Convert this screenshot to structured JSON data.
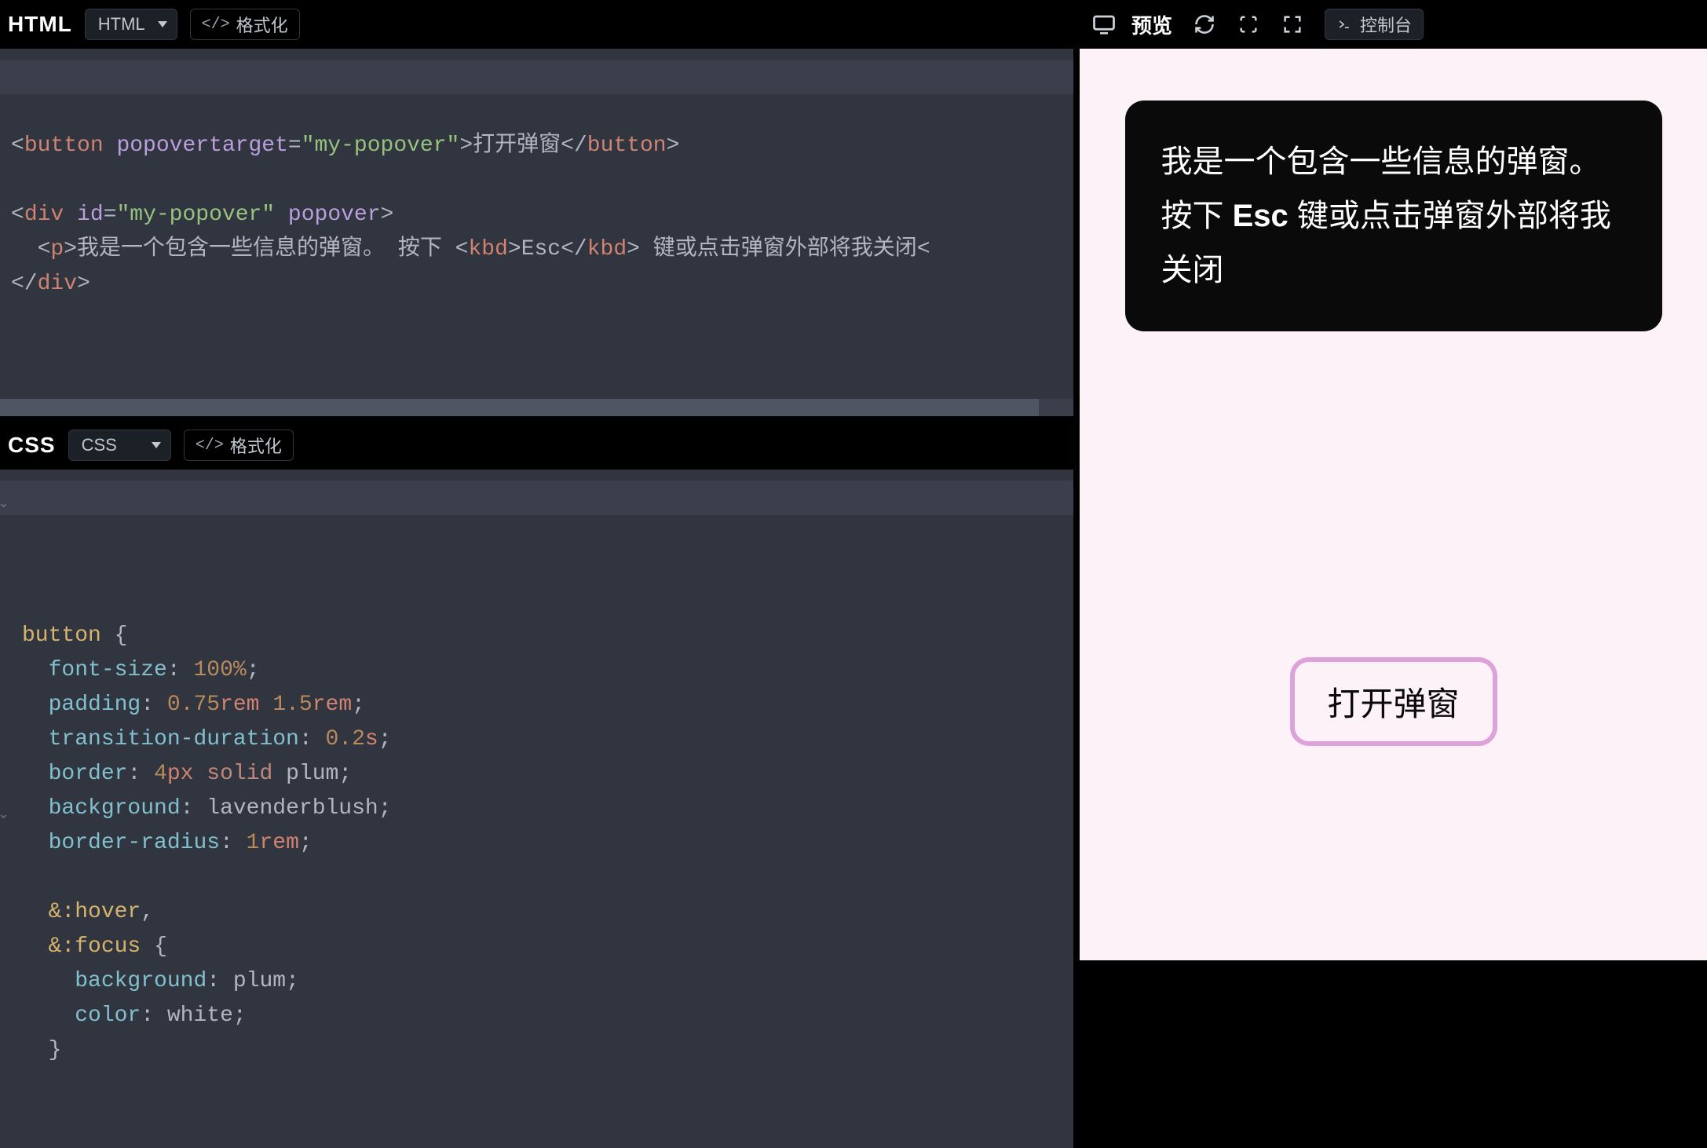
{
  "html_panel": {
    "title": "HTML",
    "lang_selected": "HTML",
    "format_label": "格式化",
    "code_tokens": {
      "button_open": "button",
      "popovertarget_attr": "popovertarget",
      "popovertarget_val": "\"my-popover\"",
      "button_text": "打开弹窗",
      "button_close": "button",
      "div_open": "div",
      "id_attr": "id",
      "id_val": "\"my-popover\"",
      "popover_attr": "popover",
      "p_open": "p",
      "p_text1": "我是一个包含一些信息的弹窗。 按下 ",
      "kbd_open": "kbd",
      "kbd_text": "Esc",
      "kbd_close": "kbd",
      "p_text2": " 键或点击弹窗外部将我关闭",
      "p_close_tok": "<",
      "div_close": "div"
    }
  },
  "css_panel": {
    "title": "CSS",
    "lang_selected": "CSS",
    "format_label": "格式化",
    "code": {
      "sel_button": "button",
      "brace_open": "{",
      "prop_fs": "font-size",
      "val_fs": "100%",
      "prop_pad": "padding",
      "val_pad1": "0.75",
      "val_pad1u": "rem",
      "val_pad2": "1.5",
      "val_pad2u": "rem",
      "prop_td": "transition-duration",
      "val_td": "0.2",
      "val_tdu": "s",
      "prop_b": "border",
      "val_b1": "4",
      "val_b1u": "px",
      "val_b2": "solid",
      "val_b3": "plum",
      "prop_bg": "background",
      "val_bg": "lavenderblush",
      "prop_br": "border-radius",
      "val_br": "1",
      "val_bru": "rem",
      "amp1": "&",
      "pseudo_hover": ":hover",
      "comma": ",",
      "amp2": "&",
      "pseudo_focus": ":focus",
      "brace_open2": "{",
      "prop_bg2": "background",
      "val_bg2": "plum",
      "prop_color": "color",
      "val_color": "white",
      "brace_close_inner": "}"
    }
  },
  "preview": {
    "label": "预览",
    "console_label": "控制台",
    "popover_text": "我是一个包含一些信息的弹窗。 按下 Esc 键或点击弹窗外部将我关闭",
    "button_label": "打开弹窗"
  }
}
